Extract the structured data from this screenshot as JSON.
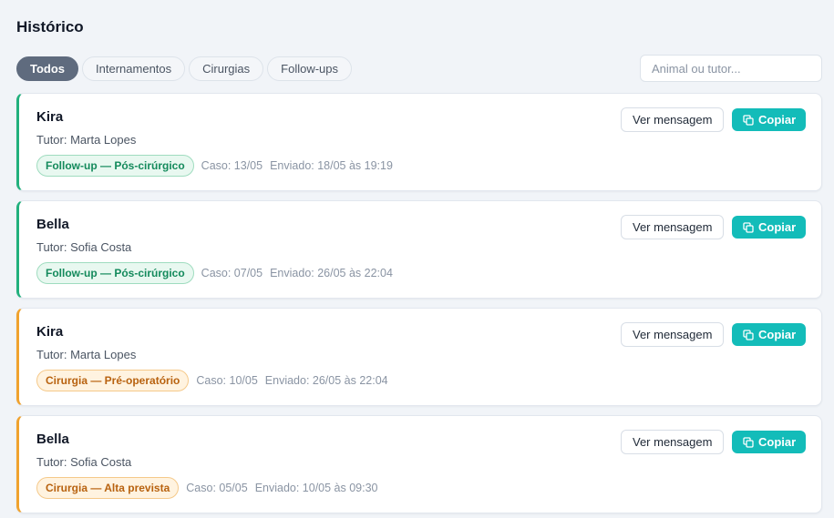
{
  "page": {
    "title": "Histórico"
  },
  "filters": {
    "tabs": [
      {
        "label": "Todos",
        "active": true
      },
      {
        "label": "Internamentos",
        "active": false
      },
      {
        "label": "Cirurgias",
        "active": false
      },
      {
        "label": "Follow-ups",
        "active": false
      }
    ]
  },
  "search": {
    "placeholder": "Animal ou tutor...",
    "value": ""
  },
  "actions": {
    "view_label": "Ver mensagem",
    "copy_label": "Copiar",
    "copy_icon": "copy-icon"
  },
  "colors": {
    "followup_accent": "#22b07d",
    "cirurgia_accent": "#f0a22e",
    "copy_button": "#13bcb9",
    "active_tab": "#5f6b7e"
  },
  "entries": [
    {
      "animal": "Kira",
      "tutor": "Tutor: Marta Lopes",
      "type": "followup",
      "badge": "Follow-up — Pós-cirúrgico",
      "caso": "Caso: 13/05",
      "enviado": "Enviado: 18/05 às 19:19"
    },
    {
      "animal": "Bella",
      "tutor": "Tutor: Sofia Costa",
      "type": "followup",
      "badge": "Follow-up — Pós-cirúrgico",
      "caso": "Caso: 07/05",
      "enviado": "Enviado: 26/05 às 22:04"
    },
    {
      "animal": "Kira",
      "tutor": "Tutor: Marta Lopes",
      "type": "cirurgia",
      "badge": "Cirurgia — Pré-operatório",
      "caso": "Caso: 10/05",
      "enviado": "Enviado: 26/05 às 22:04"
    },
    {
      "animal": "Bella",
      "tutor": "Tutor: Sofia Costa",
      "type": "cirurgia",
      "badge": "Cirurgia — Alta prevista",
      "caso": "Caso: 05/05",
      "enviado": "Enviado: 10/05 às 09:30"
    }
  ]
}
